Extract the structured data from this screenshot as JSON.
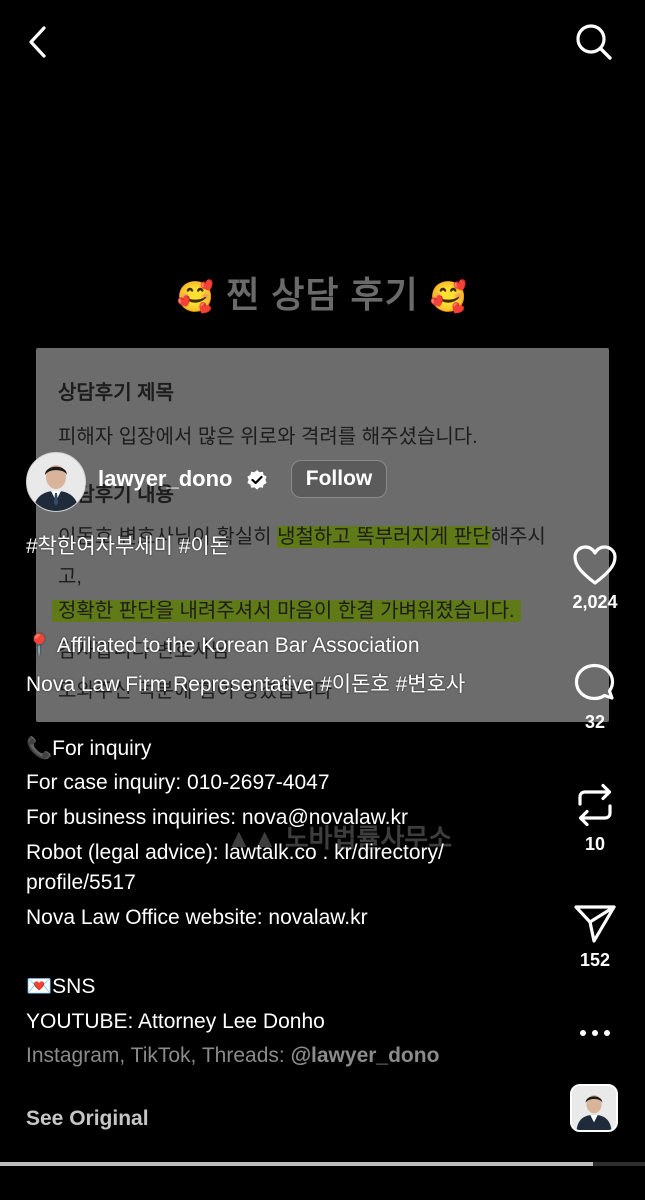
{
  "header": {
    "back_icon": "chevron-left-icon",
    "search_icon": "search-icon"
  },
  "video": {
    "title_text": "찐 상담 후기",
    "title_emoji": "🥰",
    "card": {
      "heading": "상담후기 제목",
      "line1": "피해자 입장에서 많은 위로와 격려를 해주셨습니다.",
      "heading2": "상담후기 내용",
      "line2_pre": "이돈호 변호사님이 확실히 ",
      "line2_hl": "냉철하고 똑부러지게 판단",
      "line2_post": "해주시",
      "line3": "고,",
      "line4_hl": "정확한 판단을 내려주셔서 마음이 한결 가벼워졌습니다.",
      "line5": "감사합니다 변호사님",
      "line6": "도와주신 덕분에 힘이 생겼습니다"
    },
    "watermark": "노바법률사무소"
  },
  "author": {
    "username": "lawyer_dono",
    "follow_label": "Follow"
  },
  "caption": {
    "line1": "#착한여자부세미 #이돈",
    "line2": "📍 Affiliated to the Korean Bar Association",
    "line3": "Nova Law Firm Representative #이돈호 #변호사",
    "line4": "📞For inquiry",
    "line5": "For case inquiry: 010-2697-4047",
    "line6": "For business inquiries: nova@novalaw.kr",
    "line7": "Robot (legal advice): lawtalk.co . kr/directory/",
    "line8": "profile/5517",
    "line9": "Nova Law Office website: novalaw.kr",
    "line10": "💌SNS",
    "line11": "YOUTUBE: Attorney Lee Donho",
    "line12_pre": "Instagram, TikTok, Threads: ",
    "line12_handle": "@lawyer_dono",
    "see_original": "See Original"
  },
  "actions": {
    "likes": "2,024",
    "comments": "32",
    "reposts": "10",
    "shares": "152"
  },
  "progress": {
    "fraction": 0.92
  }
}
